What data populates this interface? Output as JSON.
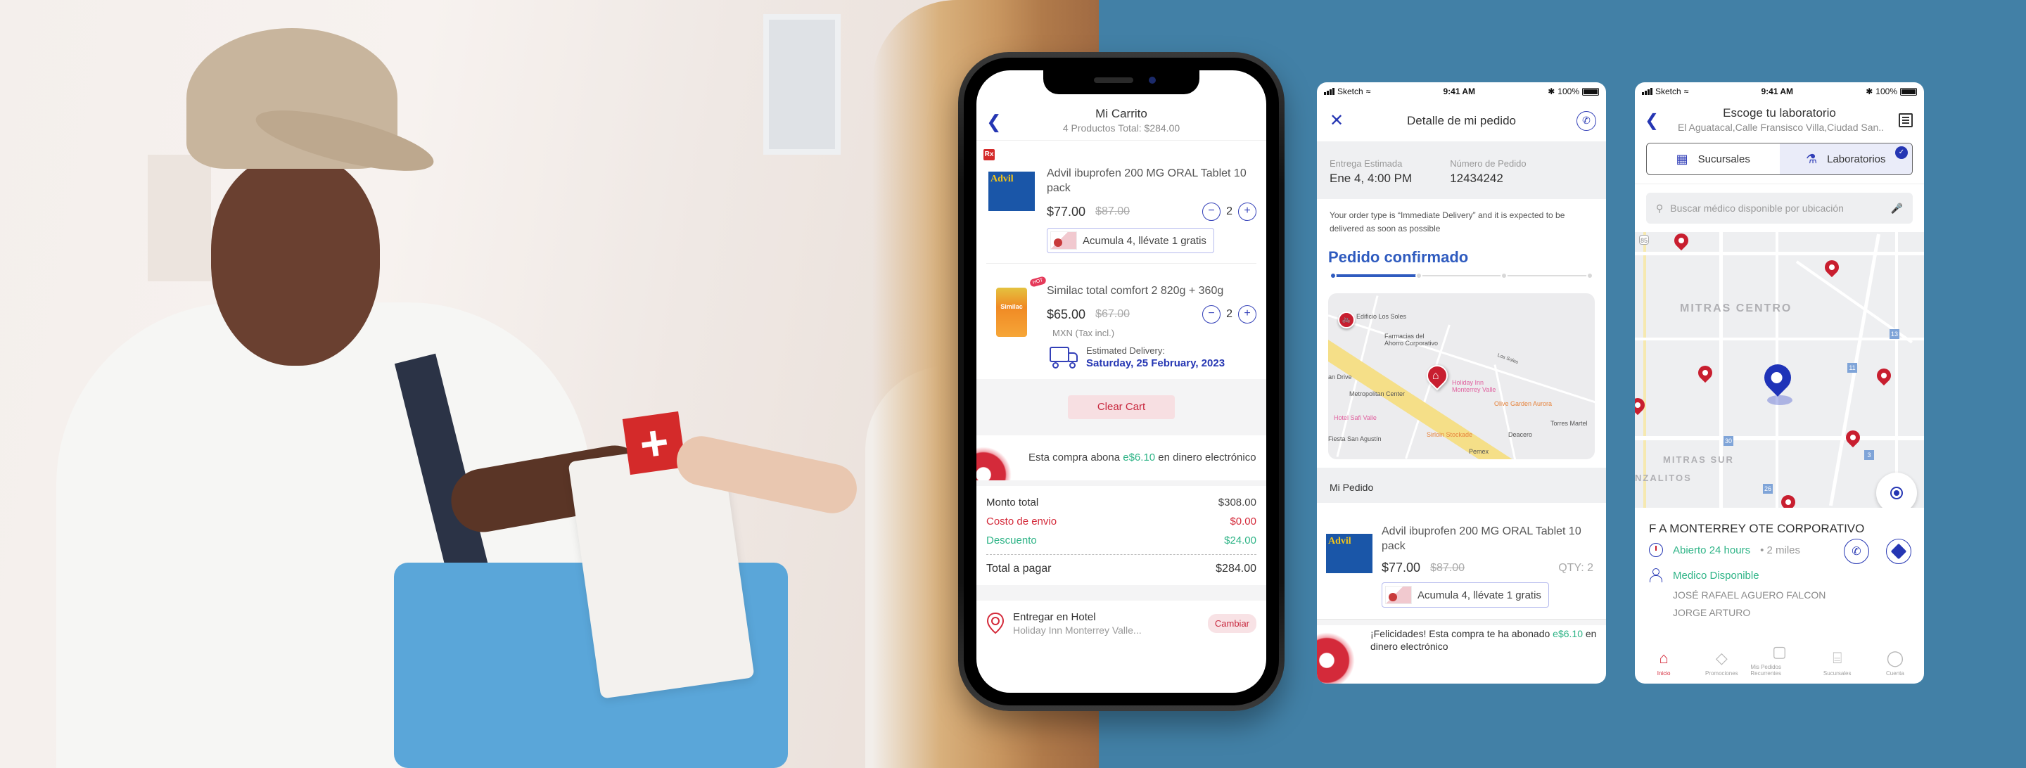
{
  "colors": {
    "background": "#4280a6",
    "primary_blue": "#2536b3",
    "accent_red": "#d42a3a",
    "accent_green": "#2fb487"
  },
  "photo": {
    "description": "Delivery man handing a pharmacy bag with red cross to a customer",
    "bag_symbol": "+"
  },
  "cart": {
    "title": "Mi Carrito",
    "subtitle": "4 Productos Total: $284.00",
    "back_icon": "chevron-left-icon",
    "items": [
      {
        "rx_badge": "Rx",
        "thumb_label": "Advil",
        "name": "Advil ibuprofen 200 MG ORAL Tablet 10 pack",
        "price": "$77.00",
        "old_price": "$87.00",
        "qty": "2",
        "minus": "−",
        "plus": "+",
        "promo": "Acumula 4, llévate 1 gratis"
      },
      {
        "hot_badge": "HOT",
        "thumb_label": "Similac",
        "name": "Similac total comfort 2 820g + 360g",
        "price": "$65.00",
        "old_price": "$67.00",
        "qty": "2",
        "minus": "−",
        "plus": "+",
        "tax_note": "MXN (Tax incl.)",
        "eta_label": "Estimated Delivery:",
        "eta_date": "Saturday, 25 February, 2023"
      }
    ],
    "clear_cart": "Clear Cart",
    "ecash": {
      "prefix": "Esta compra abona ",
      "amount": "e$6.10",
      "suffix": " en dinero electrónico"
    },
    "summary": {
      "rows": [
        {
          "label": "Monto total",
          "value": "$308.00"
        },
        {
          "label": "Costo de envio",
          "value": "$0.00"
        },
        {
          "label": "Descuento",
          "value": "$24.00"
        }
      ],
      "total_label": "Total a pagar",
      "total_value": "$284.00"
    },
    "delivery": {
      "title": "Entregar en Hotel",
      "address": "Holiday Inn Monterrey Valle...",
      "change_button": "Cambiar"
    }
  },
  "status_bar": {
    "carrier": "Sketch",
    "time": "9:41 AM",
    "battery": "100%"
  },
  "order_detail": {
    "title": "Detalle de mi pedido",
    "close_icon": "close-icon",
    "call_icon": "phone-icon",
    "eta_label": "Entrega Estimada",
    "eta_value": "Ene 4, 4:00 PM",
    "order_label": "Número de Pedido",
    "order_value": "12434242",
    "note": "Your order type is “Immediate Delivery” and it is expected to be delivered as soon as possible",
    "status_title": "Pedido confirmado",
    "progress": {
      "current_step": 1,
      "total_steps": 4
    },
    "map": {
      "pois": [
        {
          "label": "Edificio Los Soles",
          "kind": "gray"
        },
        {
          "label": "Farmacias del Ahorro Corporativo",
          "kind": "gray"
        },
        {
          "label": "Los Soles",
          "kind": "street"
        },
        {
          "label": "Metropolitan Center",
          "kind": "gray"
        },
        {
          "label": "Holiday Inn Monterrey Valle",
          "kind": "pink"
        },
        {
          "label": "Olive Garden Aurora",
          "kind": "orange"
        },
        {
          "label": "Hotel Safi Valle",
          "kind": "pink"
        },
        {
          "label": "Sirloin Stockade",
          "kind": "orange"
        },
        {
          "label": "Deacero",
          "kind": "gray"
        },
        {
          "label": "Torres Martel",
          "kind": "gray"
        },
        {
          "label": "Fiesta San Agustín",
          "kind": "gray"
        },
        {
          "label": "Pemex",
          "kind": "gray"
        },
        {
          "label": "an Drive",
          "kind": "gray"
        }
      ]
    },
    "my_order_header": "Mi Pedido",
    "item": {
      "thumb_label": "Advil",
      "name": "Advil ibuprofen 200 MG ORAL Tablet 10 pack",
      "price": "$77.00",
      "old_price": "$87.00",
      "qty": "QTY: 2",
      "promo": "Acumula 4, llévate 1 gratis"
    },
    "ecash": {
      "prefix": "¡Felicidades! Esta compra te ha abonado ",
      "amount": "e$6.10",
      "suffix": " en dinero electrónico"
    }
  },
  "lab_finder": {
    "title": "Escoge tu laboratorio",
    "subtitle": "El Aguatacal,Calle Fransisco Villa,Ciudad San..",
    "tabs": [
      {
        "label": "Sucursales",
        "active": false
      },
      {
        "label": "Laboratorios",
        "active": true
      }
    ],
    "check": "✓",
    "search_placeholder": "Buscar médico disponible por ubicación",
    "map": {
      "areas": [
        "MITRAS CENTRO",
        "MITRAS SUR",
        "NZALITOS"
      ],
      "route_numbers": [
        "85",
        "13",
        "11",
        "30",
        "3",
        "26"
      ]
    },
    "store": {
      "name": "F A MONTERREY OTE  CORPORATIVO",
      "hours": "Abierto 24 hours",
      "distance": "2 miles",
      "doctor_status": "Medico Disponible",
      "doctors": [
        "JOSÉ RAFAEL AGUERO FALCON",
        "JORGE ARTURO"
      ]
    },
    "nav": [
      {
        "label": "Inicio",
        "icon": "⌂",
        "active": true
      },
      {
        "label": "Promociones",
        "icon": "◇",
        "active": false
      },
      {
        "label": "Mis Pedidos Recurrentes",
        "icon": "▢",
        "active": false
      },
      {
        "label": "Sucursales",
        "icon": "⌸",
        "active": false
      },
      {
        "label": "Cuenta",
        "icon": "◯",
        "active": false
      }
    ]
  }
}
